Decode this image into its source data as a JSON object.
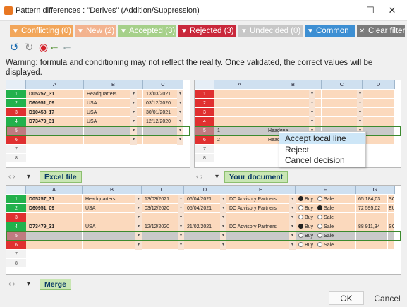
{
  "window": {
    "title": "Pattern differences : \"Derives\" (Addition/Suppression)",
    "min": "—",
    "max": "☐",
    "close": "✕"
  },
  "filters": [
    {
      "label": "Conflicting (0)",
      "color": "#f2a65a"
    },
    {
      "label": "New (2)",
      "color": "#f3b38f"
    },
    {
      "label": "Accepted (3)",
      "color": "#a6d08a"
    },
    {
      "label": "Rejected (3)",
      "color": "#c9283b"
    },
    {
      "label": "Undecided (0)",
      "color": "#c7c7c7"
    },
    {
      "label": "Common",
      "color": "#3d8fd3"
    },
    {
      "label": "Clear filter",
      "color": "#7b7b7b"
    }
  ],
  "toolbar": {
    "undo": "undo-icon",
    "redo": "redo-icon",
    "target": "target-icon",
    "expand": "expand-icon",
    "collapse": "collapse-icon"
  },
  "warning": "Warning: formula and conditioning may not reflect the reality. Once validated, the correct values will be displayed.",
  "excel": {
    "label": "Excel file",
    "cols": [
      "A",
      "B",
      "C"
    ],
    "rows": [
      {
        "n": "1",
        "status": "accepted",
        "a": "D05257_31",
        "b": "Headquarters",
        "c": "13/03/2021"
      },
      {
        "n": "2",
        "status": "accepted",
        "a": "D60951_09",
        "b": "USA",
        "c": "03/12/2020"
      },
      {
        "n": "3",
        "status": "rejected",
        "a": "D10458_17",
        "b": "USA",
        "c": "30/01/2021"
      },
      {
        "n": "4",
        "status": "accepted",
        "a": "D73479_31",
        "b": "USA",
        "c": "12/12/2020"
      },
      {
        "n": "5",
        "status": "new",
        "a": "",
        "b": "",
        "c": ""
      },
      {
        "n": "6",
        "status": "rejected",
        "a": "",
        "b": "",
        "c": ""
      },
      {
        "n": "7",
        "status": "empty",
        "a": "",
        "b": "",
        "c": ""
      },
      {
        "n": "8",
        "status": "empty",
        "a": "",
        "b": "",
        "c": ""
      }
    ]
  },
  "yours": {
    "label": "Your document",
    "cols": [
      "A",
      "B",
      "C",
      "D"
    ],
    "rows": [
      {
        "n": "1",
        "status": "rejected",
        "a": "",
        "b": ""
      },
      {
        "n": "2",
        "status": "rejected",
        "a": "",
        "b": ""
      },
      {
        "n": "3",
        "status": "rejected",
        "a": "",
        "b": ""
      },
      {
        "n": "4",
        "status": "rejected",
        "a": "",
        "b": ""
      },
      {
        "n": "5",
        "status": "new",
        "a": "1",
        "b": "Headqua"
      },
      {
        "n": "6",
        "status": "rejected",
        "a": "2",
        "b": "Headqua"
      },
      {
        "n": "7",
        "status": "empty",
        "a": "",
        "b": ""
      },
      {
        "n": "8",
        "status": "empty",
        "a": "",
        "b": ""
      }
    ]
  },
  "context_menu": [
    "Accept local line",
    "Reject",
    "Cancel decision"
  ],
  "merge": {
    "label": "Merge",
    "cols": [
      "A",
      "B",
      "C",
      "D",
      "E",
      "F",
      "G"
    ],
    "buy": "Buy",
    "sale": "Sale",
    "rows": [
      {
        "n": "1",
        "status": "accepted",
        "a": "D05257_31",
        "b": "Headquarters",
        "c": "13/03/2021",
        "d": "06/04/2021",
        "e": "DC Advisory Partners",
        "f": "buy",
        "g": "65 184,03",
        "h": "SC"
      },
      {
        "n": "2",
        "status": "accepted",
        "a": "D60951_09",
        "b": "USA",
        "c": "03/12/2020",
        "d": "05/04/2021",
        "e": "DC Advisory Partners",
        "f": "sale",
        "g": "72 595,02",
        "h": "EU"
      },
      {
        "n": "3",
        "status": "rejected",
        "a": "",
        "b": "",
        "c": "",
        "d": "",
        "e": "",
        "f": "none",
        "g": "",
        "h": ""
      },
      {
        "n": "4",
        "status": "accepted",
        "a": "D73479_31",
        "b": "USA",
        "c": "12/12/2020",
        "d": "21/02/2021",
        "e": "DC Advisory Partners",
        "f": "buy",
        "g": "88 911,34",
        "h": "SC"
      },
      {
        "n": "5",
        "status": "new",
        "a": "",
        "b": "",
        "c": "",
        "d": "",
        "e": "",
        "f": "none",
        "g": "",
        "h": ""
      },
      {
        "n": "6",
        "status": "rejected",
        "a": "",
        "b": "",
        "c": "",
        "d": "",
        "e": "",
        "f": "none",
        "g": "",
        "h": ""
      },
      {
        "n": "7",
        "status": "empty",
        "a": "",
        "b": "",
        "c": "",
        "d": "",
        "e": "",
        "f": "blank",
        "g": "",
        "h": ""
      },
      {
        "n": "8",
        "status": "empty",
        "a": "",
        "b": "",
        "c": "",
        "d": "",
        "e": "",
        "f": "blank",
        "g": "",
        "h": ""
      }
    ]
  },
  "footer": {
    "ok": "OK",
    "cancel": "Cancel"
  },
  "colors": {
    "accepted": "#22b14c",
    "rejected": "#e03030",
    "new": "#c07a80",
    "row_fill": "#fbd9bd",
    "new_fill": "#c9c9c9",
    "empty_rn": "#f2f2f2"
  }
}
